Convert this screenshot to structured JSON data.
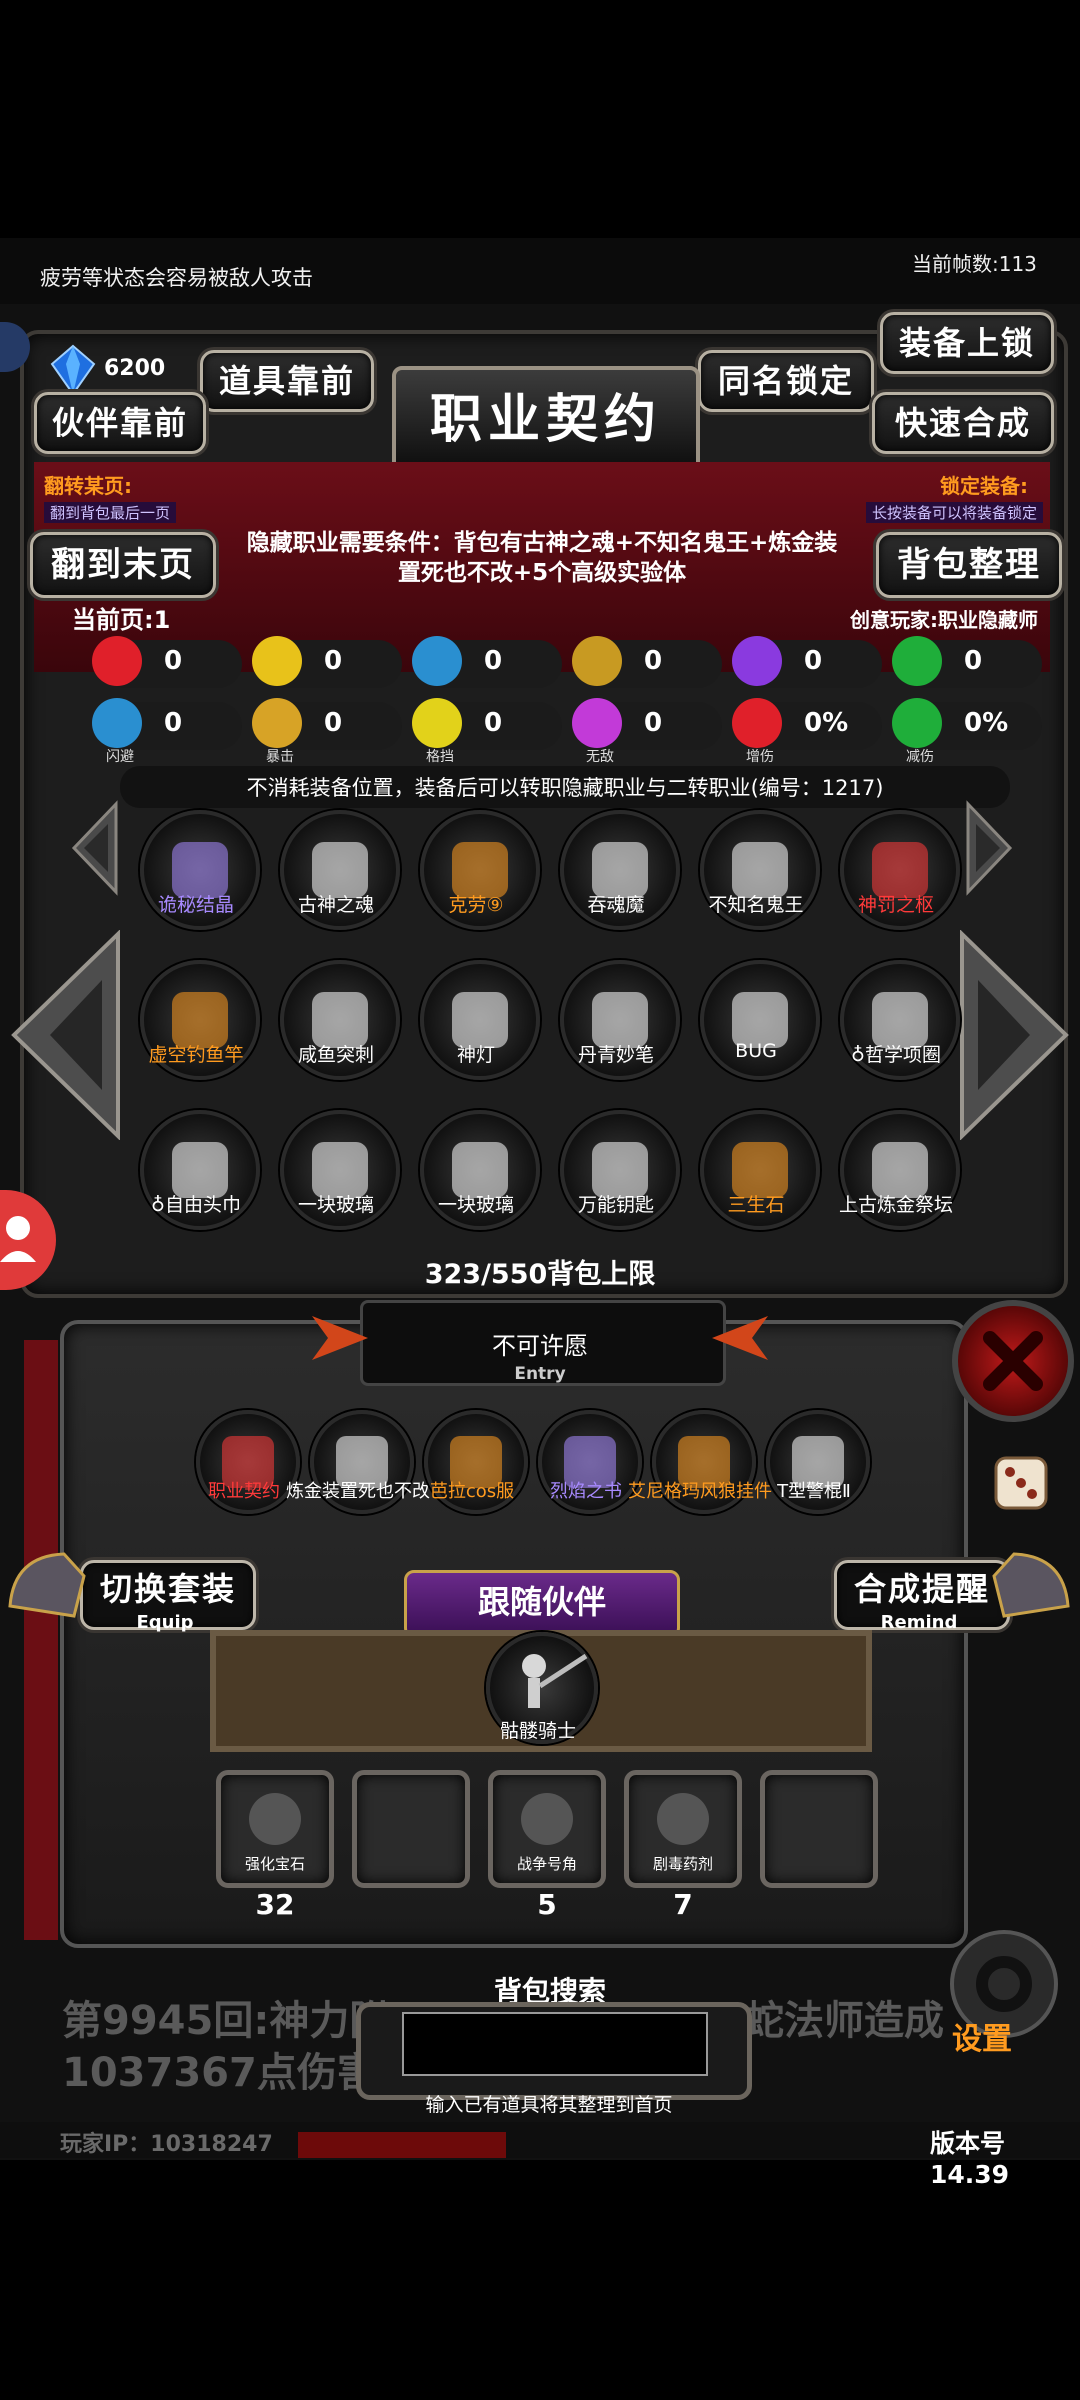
{
  "hud": {
    "tip": "疲劳等状态会容易被敌人攻击",
    "fps": "当前帧数:113",
    "gems": "6200"
  },
  "buttons": {
    "items_front": "道具靠前",
    "partner_front": "伙伴靠前",
    "same_name_lock": "同名锁定",
    "equip_lock": "装备上锁",
    "quick_craft": "快速合成",
    "to_last_page": "翻到末页",
    "bag_sort": "背包整理",
    "switch_set": "切换套装",
    "switch_set_sub": "Equip",
    "craft_remind": "合成提醒",
    "craft_remind_sub": "Remind",
    "settings": "设置"
  },
  "panel": {
    "title": "职业契约",
    "flip_label": "翻转某页:",
    "flip_desc": "翻到背包最后一页",
    "lock_label": "锁定装备:",
    "lock_desc": "长按装备可以将装备锁定",
    "requirement": "隐藏职业需要条件：背包有古神之魂+不知名鬼王+炼金装置死也不改+5个高级实验体",
    "current_page": "当前页:1",
    "creator": "创意玩家:职业隐藏师",
    "description": "不消耗装备位置，装备后可以转职隐藏职业与二转职业(编号：1217)"
  },
  "stats": [
    {
      "icon": "heart-icon",
      "value": "0",
      "label": "",
      "color": "#e0202a"
    },
    {
      "icon": "armor-icon",
      "value": "0",
      "label": "",
      "color": "#e8c21a"
    },
    {
      "icon": "helmet-icon",
      "value": "0",
      "label": "",
      "color": "#2a8fd0"
    },
    {
      "icon": "sword-icon",
      "value": "0",
      "label": "",
      "color": "#c89a22"
    },
    {
      "icon": "lightning-icon",
      "value": "0",
      "label": "",
      "color": "#8a3adf"
    },
    {
      "icon": "clover-icon",
      "value": "0",
      "label": "",
      "color": "#1fae3a"
    },
    {
      "icon": "dodge-icon",
      "value": "0",
      "label": "闪避",
      "color": "#2a8fd0"
    },
    {
      "icon": "crit-icon",
      "value": "0",
      "label": "暴击",
      "color": "#d7a326"
    },
    {
      "icon": "block-icon",
      "value": "0",
      "label": "格挡",
      "color": "#e2d21a"
    },
    {
      "icon": "invincible-icon",
      "value": "0",
      "label": "无敌",
      "color": "#c23ad8"
    },
    {
      "icon": "damage-up-icon",
      "value": "0%",
      "label": "增伤",
      "color": "#e0202a"
    },
    {
      "icon": "damage-down-icon",
      "value": "0%",
      "label": "减伤",
      "color": "#1fae3a"
    }
  ],
  "bag_items": [
    {
      "name": "诡秘结晶",
      "color": "#a88aff",
      "icon": "blue-crystal-icon"
    },
    {
      "name": "古神之魂",
      "color": "#ffffff",
      "icon": "red-soul-icon"
    },
    {
      "name": "克劳⑨",
      "color": "#ff9b1f",
      "icon": "warrior-icon"
    },
    {
      "name": "吞魂魔",
      "color": "#ffffff",
      "icon": "red-demon-icon"
    },
    {
      "name": "不知名鬼王",
      "color": "#ffffff",
      "icon": "ghost-king-icon"
    },
    {
      "name": "神罚之枢",
      "color": "#ff3a3a",
      "icon": "golden-cross-icon"
    },
    {
      "name": "虚空钓鱼竿",
      "color": "#ff9b1f",
      "icon": "fishing-rod-icon"
    },
    {
      "name": "咸鱼突刺",
      "color": "#ffffff",
      "icon": "spear-icon"
    },
    {
      "name": "神灯",
      "color": "#ffffff",
      "icon": "magic-lamp-icon"
    },
    {
      "name": "丹青妙笔",
      "color": "#ffffff",
      "icon": "brush-icon"
    },
    {
      "name": "BUG",
      "color": "#ffffff",
      "icon": "bug-icon"
    },
    {
      "name": "♁哲学项圈",
      "color": "#ffffff",
      "icon": "collar-icon"
    },
    {
      "name": "♁自由头巾",
      "color": "#ffffff",
      "icon": "bandana-icon"
    },
    {
      "name": "一块玻璃",
      "color": "#ffffff",
      "icon": "glass-icon"
    },
    {
      "name": "一块玻璃",
      "color": "#ffffff",
      "icon": "glass-icon"
    },
    {
      "name": "万能钥匙",
      "color": "#ffffff",
      "icon": "key-icon"
    },
    {
      "name": "三生石",
      "color": "#ff9b1f",
      "icon": "stone-icon"
    },
    {
      "name": "上古炼金祭坛",
      "color": "#ffffff",
      "icon": "altar-icon"
    }
  ],
  "bag_capacity": "323/550背包上限",
  "wish": {
    "title": "不可许愿",
    "sub": "Entry"
  },
  "equipped": [
    {
      "name": "职业契约",
      "color": "#ff3a3a",
      "icon": "contract-icon"
    },
    {
      "name": "炼金装置死也不改",
      "color": "#ffffff",
      "icon": "alchemy-icon"
    },
    {
      "name": "芭拉cos服",
      "color": "#ff9b1f",
      "icon": "costume-icon"
    },
    {
      "name": "烈焰之书",
      "color": "#a88aff",
      "icon": "flame-book-icon"
    },
    {
      "name": "艾尼格玛风狼挂件",
      "color": "#ff9b1f",
      "icon": "wolf-pendant-icon"
    },
    {
      "name": "T型警棍Ⅱ",
      "color": "#ffffff",
      "icon": "baton-icon"
    }
  ],
  "partner": {
    "title": "跟随伙伴",
    "name": "骷髅骑士"
  },
  "consumables": [
    {
      "name": "强化宝石",
      "count": "32",
      "icon": "green-gem-icon"
    },
    {
      "name": "",
      "count": "",
      "icon": ""
    },
    {
      "name": "战争号角",
      "count": "5",
      "icon": "war-horn-icon"
    },
    {
      "name": "剧毒药剂",
      "count": "7",
      "icon": "poison-icon"
    },
    {
      "name": "",
      "count": "",
      "icon": ""
    }
  ],
  "search": {
    "title": "背包搜索",
    "hint": "输入已有道具将其整理到首页",
    "value": ""
  },
  "battle_log": "第9945回:神力附体…蛇法师造成1037367点伤害",
  "battle_log_line1": "第9945回:神力附",
  "battle_log_line1b": "蛇法师造成",
  "battle_log_line2": "1037367点伤害",
  "player_ip": "玩家IP：10318247",
  "version": "版本号14.39"
}
